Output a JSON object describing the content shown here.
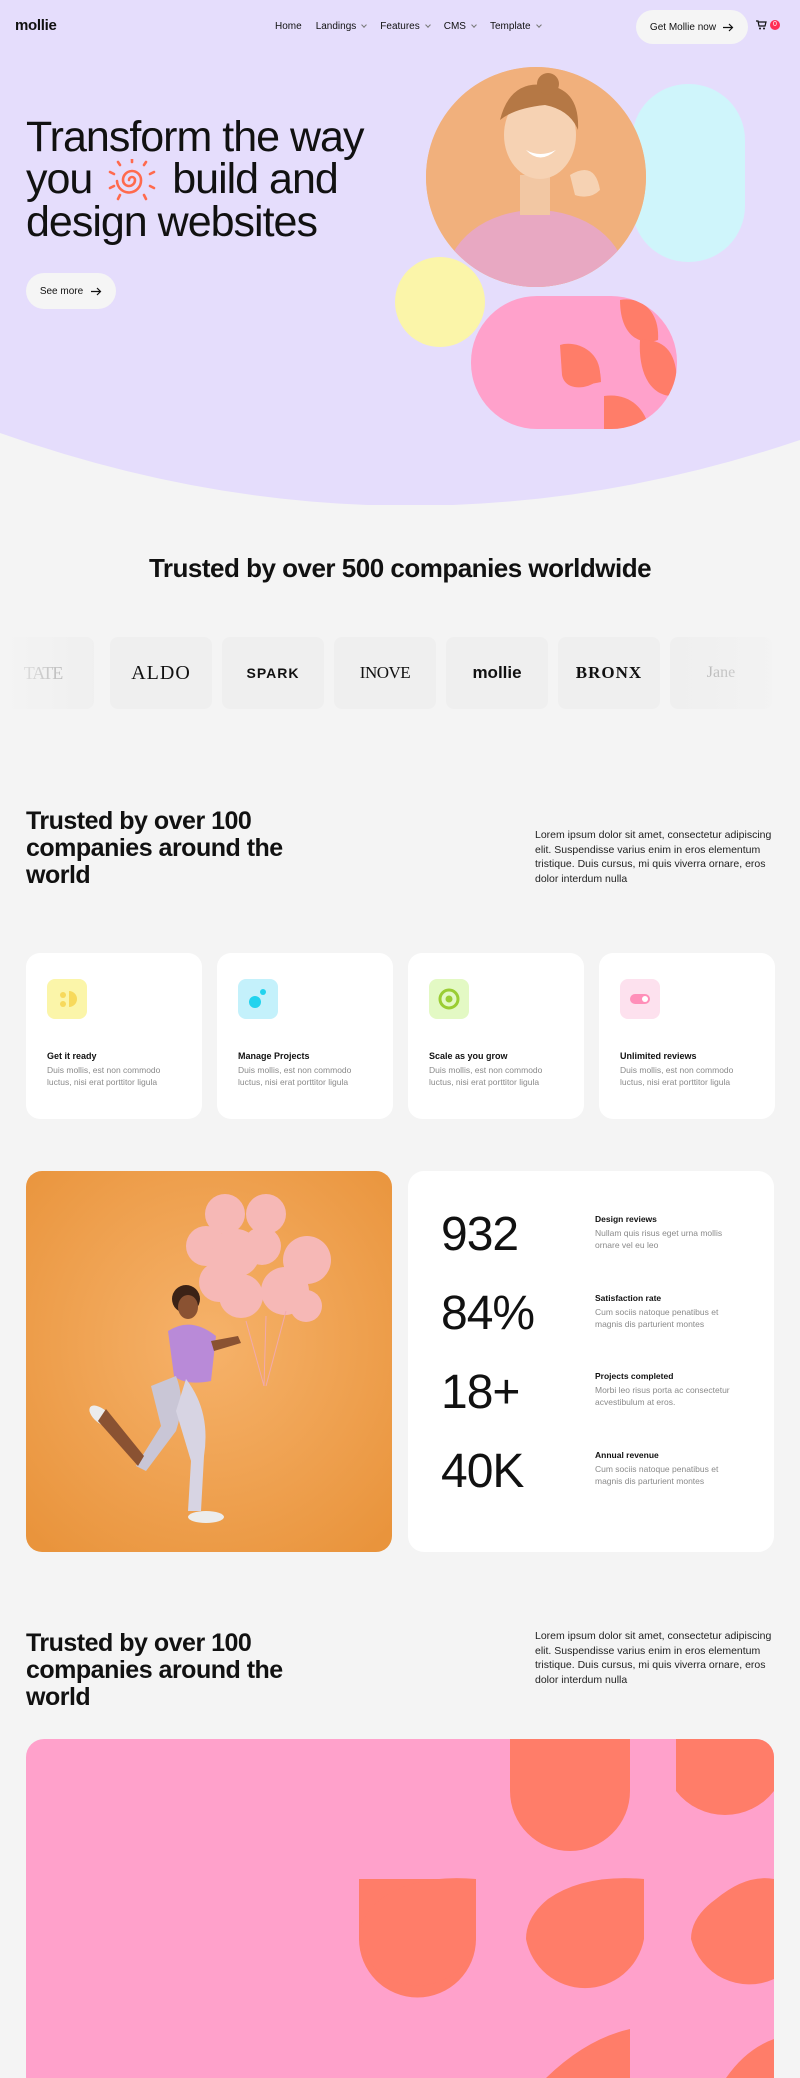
{
  "colors": {
    "hero_bg": "#e5ddfc",
    "page_bg": "#f4f4f4",
    "pink": "#ffa1cb",
    "coral": "#ff7d69",
    "yellow": "#fbf5a9",
    "cyan": "#cff5fb",
    "badge": "#ff2d55"
  },
  "nav": {
    "logo": "mollie",
    "menu": [
      {
        "label": "Home",
        "has_dropdown": false
      },
      {
        "label": "Landings",
        "has_dropdown": true
      },
      {
        "label": "Features",
        "has_dropdown": true
      },
      {
        "label": "CMS",
        "has_dropdown": true
      },
      {
        "label": "Template",
        "has_dropdown": true
      }
    ],
    "cta_label": "Get Mollie now",
    "cart_count": "0"
  },
  "hero": {
    "line1": "Transform the way",
    "line2_a": "you",
    "line2_b": "build and",
    "line3": "design websites",
    "button_label": "See more"
  },
  "trusted": {
    "title": "Trusted by over 500 companies worldwide",
    "logos": [
      "TATE",
      "ALDO",
      "SPARK",
      "INOVE",
      "mollie",
      "BRONX",
      "Jane"
    ]
  },
  "section2": {
    "title": "Trusted by over 100 companies around the world",
    "text": "Lorem ipsum dolor sit amet, consectetur adipiscing elit. Suspendisse varius enim in eros elementum tristique. Duis cursus, mi quis viverra ornare, eros dolor interdum nulla"
  },
  "features": [
    {
      "title": "Get it ready",
      "desc": "Duis mollis, est non commodo luctus, nisi erat porttitor ligula",
      "icon": "smiley-icon",
      "icon_bg": "#fbf5a9",
      "icon_fg": "#f7d95c"
    },
    {
      "title": "Manage Projects",
      "desc": "Duis mollis, est non commodo luctus, nisi erat porttitor ligula",
      "icon": "dots-icon",
      "icon_bg": "#c4f1fb",
      "icon_fg": "#22d3ee"
    },
    {
      "title": "Scale as you grow",
      "desc": "Duis mollis, est non commodo luctus, nisi erat porttitor ligula",
      "icon": "target-icon",
      "icon_bg": "#e3f9c4",
      "icon_fg": "#9acd32"
    },
    {
      "title": "Unlimited reviews",
      "desc": "Duis mollis, est non commodo luctus, nisi erat porttitor ligula",
      "icon": "toggle-icon",
      "icon_bg": "#fde1ee",
      "icon_fg": "#ff8fb9"
    }
  ],
  "stats": [
    {
      "value": "932",
      "label": "Design reviews",
      "desc": "Nullam quis risus eget urna mollis ornare vel eu leo"
    },
    {
      "value": "84%",
      "label": "Satisfaction rate",
      "desc": "Cum sociis natoque penatibus et magnis dis parturient montes"
    },
    {
      "value": "18+",
      "label": "Projects completed",
      "desc": "Morbi leo risus porta ac consectetur acvestibulum at eros."
    },
    {
      "value": "40K",
      "label": "Annual revenue",
      "desc": "Cum sociis natoque penatibus et magnis dis parturient montes"
    }
  ],
  "section3": {
    "title": "Trusted by over 100 companies around the world",
    "text": "Lorem ipsum dolor sit amet, consectetur adipiscing elit. Suspendisse varius enim in eros elementum tristique. Duis cursus, mi quis viverra ornare, eros dolor interdum nulla"
  }
}
